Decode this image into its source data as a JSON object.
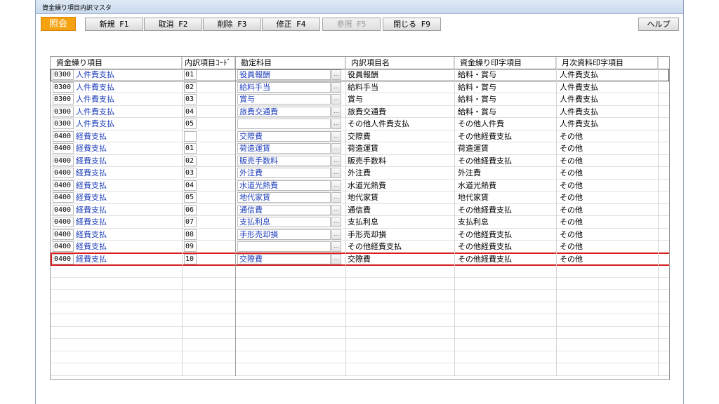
{
  "window": {
    "title": "資金繰り項目内訳マスタ"
  },
  "toolbar": {
    "mode": "照会",
    "buttons": [
      {
        "label": "新規 F1",
        "enabled": true
      },
      {
        "label": "取消 F2",
        "enabled": true
      },
      {
        "label": "削除 F3",
        "enabled": true
      },
      {
        "label": "修正 F4",
        "enabled": true
      },
      {
        "label": "参照 F5",
        "enabled": false
      },
      {
        "label": "閉じる F9",
        "enabled": true
      }
    ],
    "help": "ヘルプ"
  },
  "grid": {
    "headers": [
      "資金繰り項目",
      "内訳項目ｺｰﾄﾞ",
      "勘定科目",
      "内訳項目名",
      "資金繰り印字項目",
      "月次資料印字項目"
    ],
    "rows": [
      {
        "code": "0300",
        "item": "人件費支払",
        "sub": "01",
        "account": "役員報酬",
        "detail": "役員報酬",
        "print": "給料・賞与",
        "monthly": "人件費支払"
      },
      {
        "code": "0300",
        "item": "人件費支払",
        "sub": "02",
        "account": "給料手当",
        "detail": "給料手当",
        "print": "給料・賞与",
        "monthly": "人件費支払"
      },
      {
        "code": "0300",
        "item": "人件費支払",
        "sub": "03",
        "account": "賞与",
        "detail": "賞与",
        "print": "給料・賞与",
        "monthly": "人件費支払"
      },
      {
        "code": "0300",
        "item": "人件費支払",
        "sub": "04",
        "account": "旅費交通費",
        "detail": "旅費交通費",
        "print": "給料・賞与",
        "monthly": "人件費支払"
      },
      {
        "code": "0300",
        "item": "人件費支払",
        "sub": "05",
        "account": "",
        "detail": "その他人件費支払",
        "print": "その他人件費",
        "monthly": "人件費支払"
      },
      {
        "code": "0400",
        "item": "経費支払",
        "sub": "",
        "account": "交際費",
        "detail": "交際費",
        "print": "その他経費支払",
        "monthly": "その他"
      },
      {
        "code": "0400",
        "item": "経費支払",
        "sub": "01",
        "account": "荷造運賃",
        "detail": "荷造運賃",
        "print": "荷造運賃",
        "monthly": "その他"
      },
      {
        "code": "0400",
        "item": "経費支払",
        "sub": "02",
        "account": "販売手数料",
        "detail": "販売手数料",
        "print": "その他経費支払",
        "monthly": "その他"
      },
      {
        "code": "0400",
        "item": "経費支払",
        "sub": "03",
        "account": "外注費",
        "detail": "外注費",
        "print": "外注費",
        "monthly": "その他"
      },
      {
        "code": "0400",
        "item": "経費支払",
        "sub": "04",
        "account": "水道光熱費",
        "detail": "水道光熱費",
        "print": "水道光熱費",
        "monthly": "その他"
      },
      {
        "code": "0400",
        "item": "経費支払",
        "sub": "05",
        "account": "地代家賃",
        "detail": "地代家賃",
        "print": "地代家賃",
        "monthly": "その他"
      },
      {
        "code": "0400",
        "item": "経費支払",
        "sub": "06",
        "account": "通信費",
        "detail": "通信費",
        "print": "その他経費支払",
        "monthly": "その他"
      },
      {
        "code": "0400",
        "item": "経費支払",
        "sub": "07",
        "account": "支払利息",
        "detail": "支払利息",
        "print": "支払利息",
        "monthly": "その他"
      },
      {
        "code": "0400",
        "item": "経費支払",
        "sub": "08",
        "account": "手形売却損",
        "detail": "手形売却損",
        "print": "その他経費支払",
        "monthly": "その他"
      },
      {
        "code": "0400",
        "item": "経費支払",
        "sub": "09",
        "account": "",
        "detail": "その他経費支払",
        "print": "その他経費支払",
        "monthly": "その他"
      },
      {
        "code": "0400",
        "item": "経費支払",
        "sub": "10",
        "account": "交際費",
        "detail": "交際費",
        "print": "その他経費支払",
        "monthly": "その他"
      }
    ],
    "empty_row_count": 9,
    "highlight_row_index": 15,
    "highlight_color": "#d81e1e"
  }
}
